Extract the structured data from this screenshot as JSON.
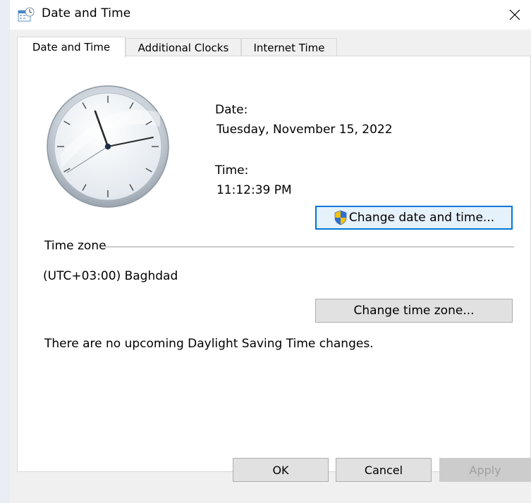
{
  "window": {
    "title": "Date and Time",
    "close_glyph": "✕"
  },
  "tabs": [
    {
      "label": "Date and Time",
      "active": true
    },
    {
      "label": "Additional Clocks",
      "active": false
    },
    {
      "label": "Internet Time",
      "active": false
    }
  ],
  "date": {
    "label": "Date:",
    "value": "Tuesday, November 15, 2022"
  },
  "time": {
    "label": "Time:",
    "value": "11:12:39 PM"
  },
  "buttons": {
    "change_date_time": "Change date and time...",
    "change_time_zone": "Change time zone...",
    "ok": "OK",
    "cancel": "Cancel",
    "apply": "Apply"
  },
  "time_zone": {
    "section_label": "Time zone",
    "value": "(UTC+03:00) Baghdad",
    "dst_message": "There are no upcoming Daylight Saving Time changes."
  },
  "icons": {
    "title": "date-time-calendar-icon",
    "shield": "uac-shield-icon",
    "close": "close-icon",
    "clock": "analog-clock-icon"
  },
  "colors": {
    "accent": "#0078d7",
    "window_bg": "#f0f0f0",
    "panel_bg": "#ffffff"
  }
}
